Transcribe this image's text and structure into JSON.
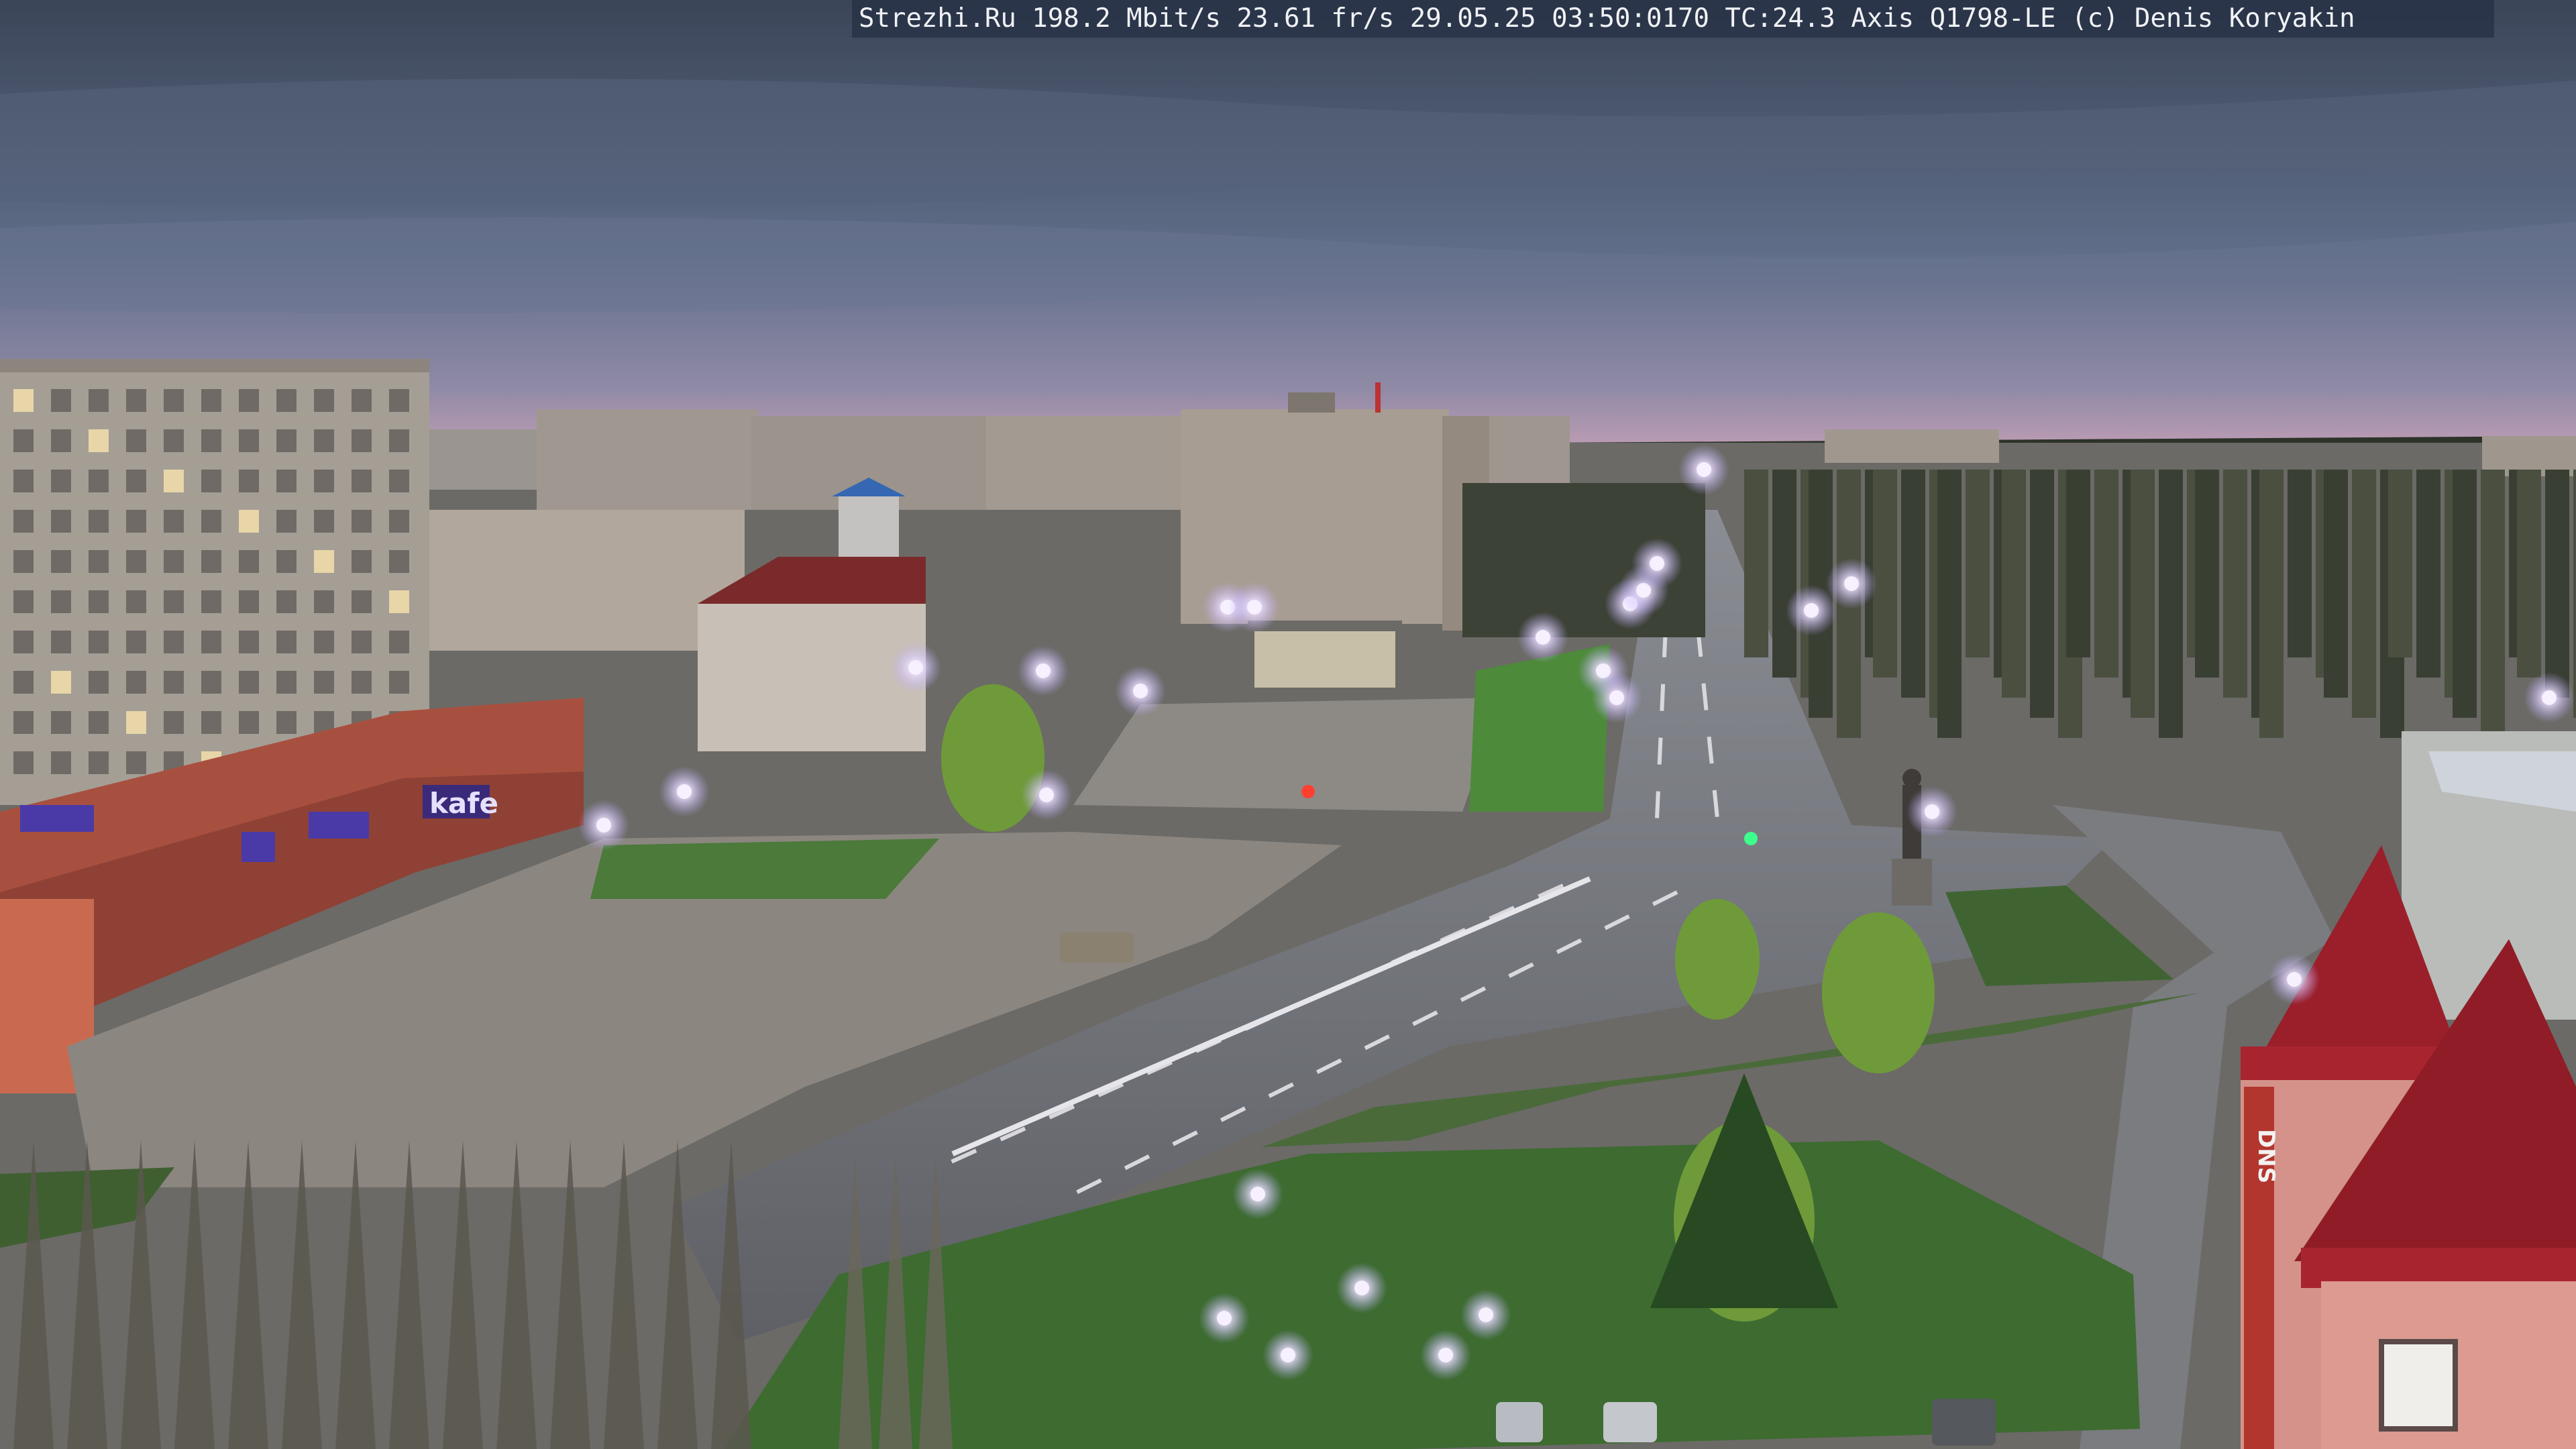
{
  "overlay": {
    "text": "Strezhi.Ru 198.2 Mbit/s 23.61 fr/s 29.05.25 03:50:0170 TC:24.3  Axis Q1798-LE  (c) Denis Koryakin"
  },
  "signs": {
    "kafe": "kafe",
    "dns": "DNS"
  },
  "colors": {
    "sky_top": "#3c475c",
    "sky_mid": "#5c6a86",
    "horizon": "#b89ab4",
    "road": "#6f7176",
    "plaza": "#8a8580",
    "grass": "#3e6a32",
    "building": "#a29a90",
    "brick": "#a24a3a",
    "roof_red": "#8e2028",
    "lamp": "#f2eaff"
  }
}
